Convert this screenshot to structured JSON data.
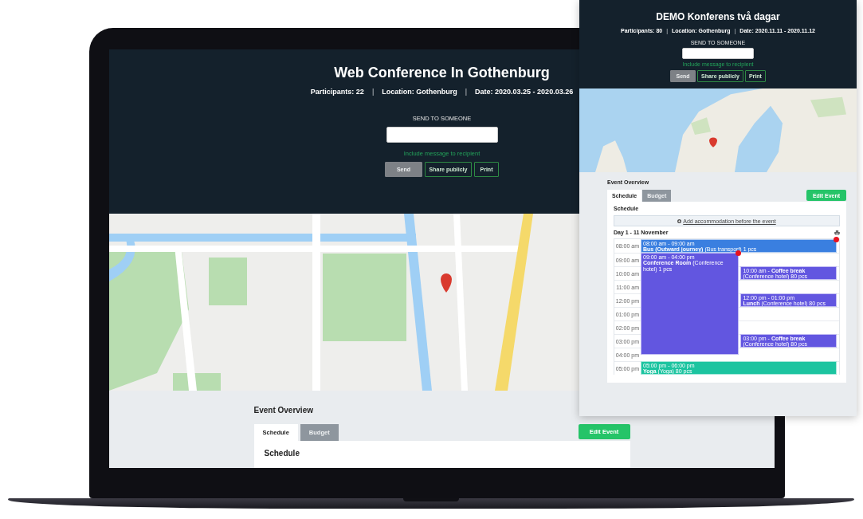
{
  "laptop_screen": {
    "header": {
      "title": "Web Conference In Gothenburg",
      "info": [
        {
          "kind": "item",
          "text": "Participants: 22"
        },
        {
          "kind": "separator",
          "text": "|"
        },
        {
          "kind": "item",
          "text": "Location: Gothenburg"
        },
        {
          "kind": "separator",
          "text": "|"
        },
        {
          "kind": "item",
          "text": "Date: 2020.03.25 - 2020.03.26"
        }
      ],
      "send_label": "SEND TO SOMEONE",
      "message_link": "Include message to recipient",
      "buttons": [
        {
          "label": "Send",
          "disabled": true
        },
        {
          "label": "Share publicly",
          "disabled": false
        },
        {
          "label": "Print",
          "disabled": false
        }
      ]
    },
    "overview": {
      "title": "Event Overview",
      "tabs": [
        {
          "label": "Schedule",
          "selected": true
        },
        {
          "label": "Budget",
          "selected": false
        }
      ],
      "edit_button": "Edit Event",
      "panel_title": "Schedule"
    }
  },
  "overlay_screen": {
    "header": {
      "title": "DEMO Konferens två dagar",
      "info": [
        {
          "kind": "item",
          "text": "Participants: 80"
        },
        {
          "kind": "separator",
          "text": "|"
        },
        {
          "kind": "item",
          "text": "Location: Gothenburg"
        },
        {
          "kind": "separator",
          "text": "|"
        },
        {
          "kind": "item",
          "text": "Date: 2020.11.11 - 2020.11.12"
        }
      ],
      "send_label": "SEND TO SOMEONE",
      "message_link": "Include message to recipient",
      "buttons": [
        {
          "label": "Send",
          "disabled": true
        },
        {
          "label": "Share publicly",
          "disabled": false
        },
        {
          "label": "Print",
          "disabled": false
        }
      ]
    },
    "overview": {
      "title": "Event Overview",
      "tabs": [
        {
          "label": "Schedule",
          "selected": true
        },
        {
          "label": "Budget",
          "selected": false
        }
      ],
      "edit_button": "Edit Event",
      "panel_title": "Schedule"
    },
    "calendar": {
      "add_accommodation": "Add accommodation before the event",
      "day_title": "Day 1 - 11 November",
      "times": [
        "08:00 am",
        "09:00 am",
        "10:00 am",
        "11:00 am",
        "12:00 pm",
        "01:00 pm",
        "02:00 pm",
        "03:00 pm",
        "04:00 pm",
        "05:00 pm"
      ],
      "events": [
        {
          "kind": "stacked",
          "time": "08:00 am - 09:00 am",
          "text": "**Bus (Outward journey)** (Bus transport) 1 pcs",
          "color": "#3a7fe0",
          "flagged": true
        },
        {
          "kind": "stacked",
          "time": "09:00 am - 04:00 pm",
          "text": "**Conference Room** (Conference hotel) 1 pcs",
          "color": "#6256e0",
          "flagged": true
        },
        {
          "kind": "inline",
          "time": "10:00 am -",
          "text": "**Coffee break** (Conference hotel) 80 pcs",
          "color": "#6256e0",
          "flagged": false
        },
        {
          "kind": "stacked",
          "time": "12:00 pm - 01:00 pm",
          "text": "**Lunch** (Conference hotel) 80 pcs",
          "color": "#6256e0",
          "flagged": false
        },
        {
          "kind": "inline",
          "time": "03:00 pm -",
          "text": "**Coffee break** (Conference hotel) 80 pcs",
          "color": "#6256e0",
          "flagged": false
        },
        {
          "kind": "stacked",
          "time": "05:00 pm - 06:00 pm",
          "text": "**Yoga** (Yoga) 80 pcs",
          "color": "#1cc4a0",
          "flagged": false
        }
      ]
    }
  }
}
